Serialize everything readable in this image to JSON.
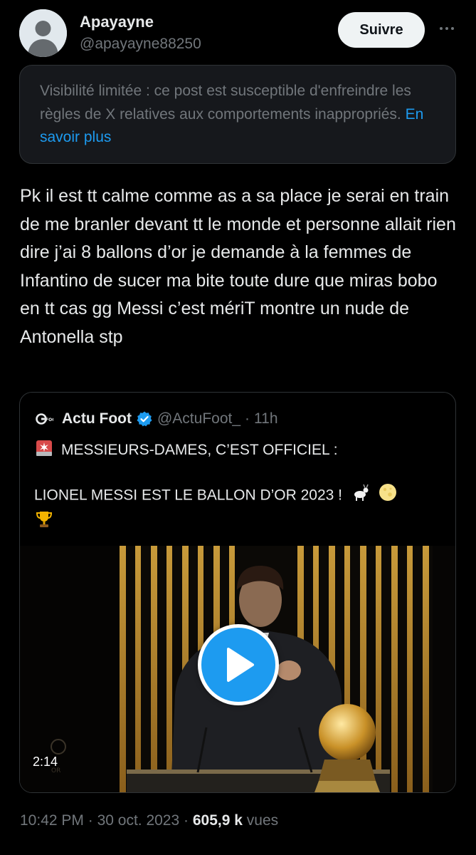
{
  "author": {
    "display_name": "Apayayne",
    "handle": "@apayayne88250"
  },
  "actions": {
    "follow_label": "Suivre",
    "more_icon": "more-horizontal-icon"
  },
  "notice": {
    "text": "Visibilité limitée : ce post est susceptible d'enfreindre les règles de X relatives aux comportements inappropriés.",
    "link_label": "En savoir plus",
    "link_color": "#1d9bf0"
  },
  "tweet": {
    "text": "Pk il est tt calme comme as a sa place je serai en train de me branler devant tt le monde et personne allait rien dire j’ai 8 ballons d’or je demande à la femmes de Infantino de sucer ma bite toute dure que miras bobo en tt cas gg Messi c’est mériT montre un nude de Antonella stp"
  },
  "quoted": {
    "logo_icon": "actu-foot-logo-icon",
    "display_name": "Actu Foot",
    "verified_icon": "verified-badge-icon",
    "handle": "@ActuFoot_",
    "separator": "·",
    "time": "11h",
    "line1_emoji": "siren-emoji-icon",
    "line1": "MESSIEURS-DAMES, C’EST OFFICIEL :",
    "line2": "LIONEL MESSI EST LE BALLON D’OR 2023 !",
    "line2_emojis": [
      "goat-emoji-icon",
      "moon-emoji-icon",
      "trophy-emoji-icon"
    ],
    "media": {
      "play_icon": "play-icon",
      "duration": "2:14"
    }
  },
  "meta": {
    "time": "10:42 PM",
    "separator": "·",
    "date": "30 oct. 2023",
    "views_count": "605,9 k",
    "views_label": "vues"
  },
  "colors": {
    "background": "#000000",
    "text": "#e7e9ea",
    "muted": "#71767b",
    "accent": "#1d9bf0",
    "border": "#2f3336"
  }
}
